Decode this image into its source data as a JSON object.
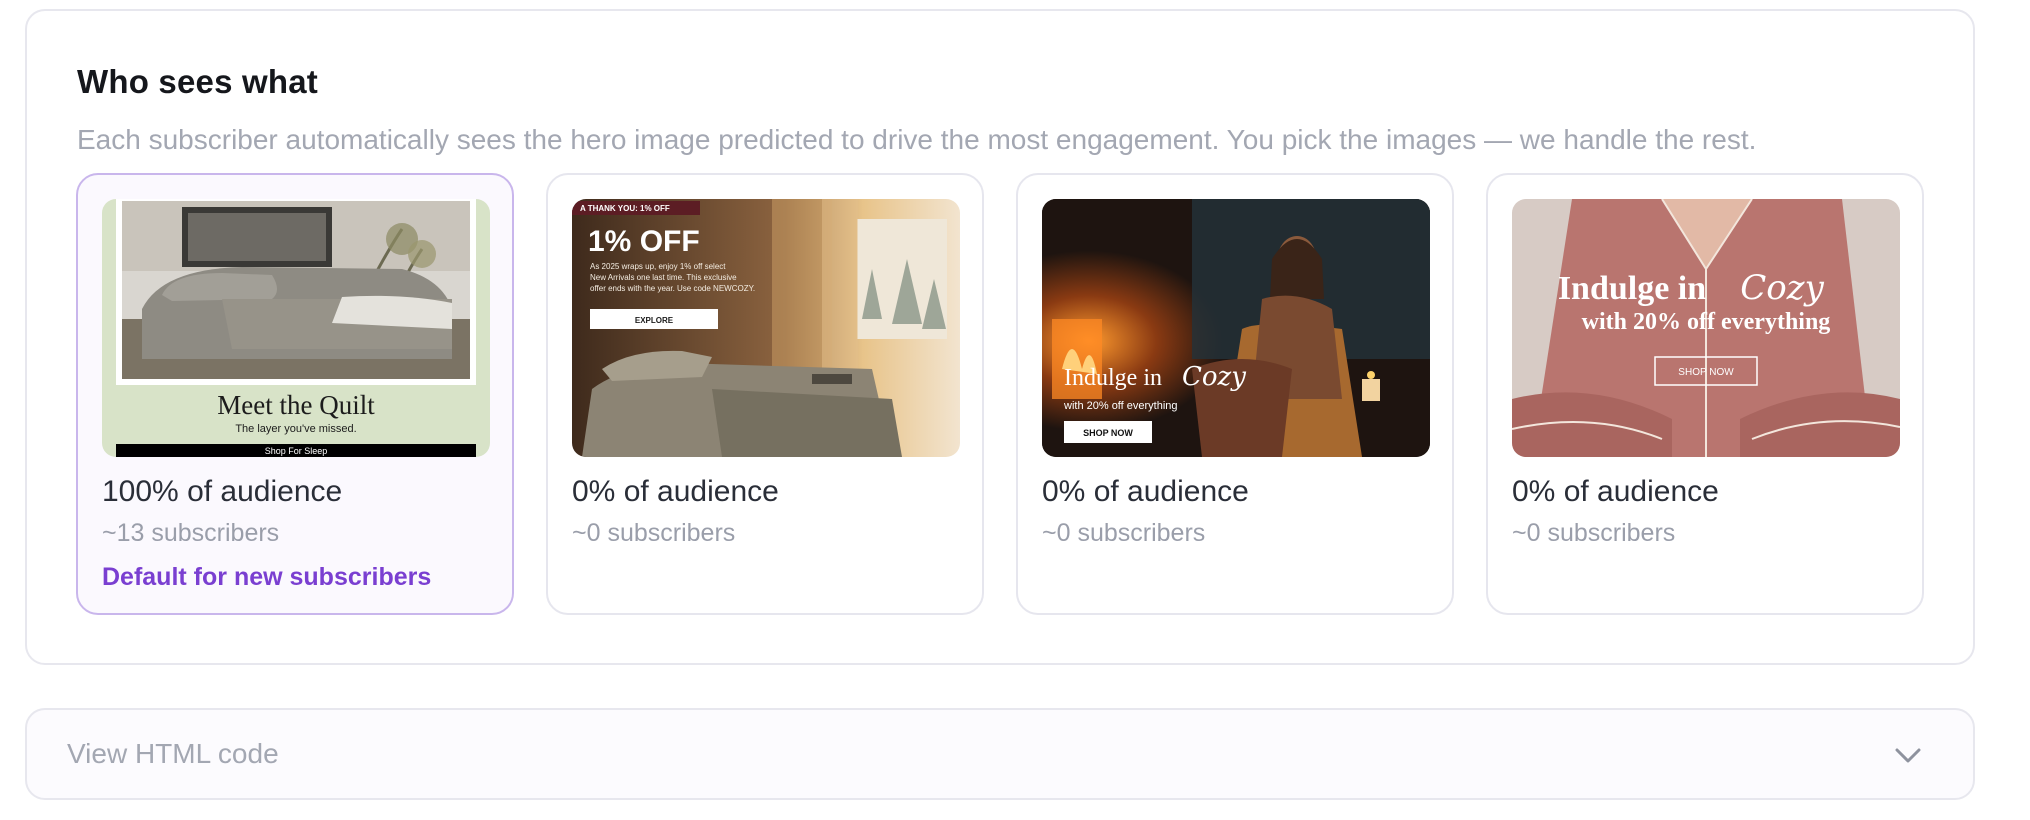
{
  "section": {
    "title": "Who sees what",
    "subtitle": "Each subscriber automatically sees the hero image predicted to drive the most engagement. You pick the images — we handle the rest."
  },
  "cards": [
    {
      "audience_percent": 100,
      "audience_label": "100% of audience",
      "subscribers_label": "~13 subscribers",
      "default_label": "Default for new subscribers",
      "selected": true,
      "image": {
        "headline": "Meet the Quilt",
        "subline": "The layer you've missed.",
        "cta": "Shop For Sleep"
      }
    },
    {
      "audience_percent": 0,
      "audience_label": "0% of audience",
      "subscribers_label": "~0 subscribers",
      "selected": false,
      "image": {
        "tag": "A THANK YOU: 1% OFF",
        "headline": "1% OFF",
        "body_lines": [
          "As 2025 wraps up, enjoy 1% off select",
          "New Arrivals one last time. This exclusive",
          "offer ends with the year. Use code NEWCOZY."
        ],
        "cta": "EXPLORE"
      }
    },
    {
      "audience_percent": 0,
      "audience_label": "0% of audience",
      "subscribers_label": "~0 subscribers",
      "selected": false,
      "image": {
        "headline_a": "Indulge in",
        "headline_b": "Cozy",
        "subline": "with 20% off everything",
        "cta": "SHOP NOW"
      }
    },
    {
      "audience_percent": 0,
      "audience_label": "0% of audience",
      "subscribers_label": "~0 subscribers",
      "selected": false,
      "image": {
        "headline_a": "Indulge in",
        "headline_b": "Cozy",
        "subline": "with 20% off everything",
        "cta": "SHOP NOW"
      }
    }
  ],
  "accordion": {
    "label": "View HTML code",
    "icon": "chevron-down-icon"
  },
  "colors": {
    "accent": "#7a3fd1",
    "selected_border": "#c9b6ec",
    "muted_text": "#a3a7b2"
  }
}
